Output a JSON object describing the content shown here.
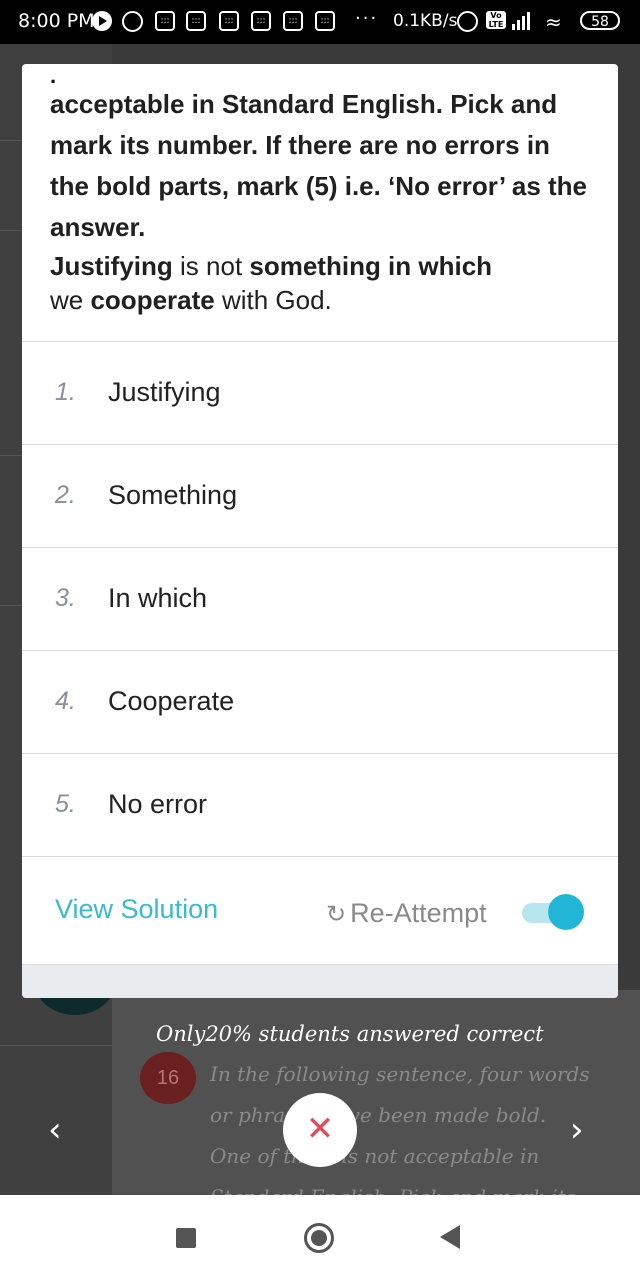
{
  "status_bar": {
    "time": "8:00 PM",
    "network_speed": "0.1KB/s",
    "volte": "Vo LTE",
    "battery": "58",
    "overflow": "···"
  },
  "question": {
    "instruction_tail": "acceptable in Standard English. Pick and mark its number. If there are no errors in the bold parts, mark (5) i.e. ‘No error’ as the answer.",
    "sentence_parts": {
      "w1": "Justifying",
      "w2": " is not ",
      "w3": "something in which",
      "w4": "we ",
      "w5": "cooperate",
      "w6": " with God."
    }
  },
  "options": [
    {
      "num": "1.",
      "label": "Justifying"
    },
    {
      "num": "2.",
      "label": "Something"
    },
    {
      "num": "3.",
      "label": "In which"
    },
    {
      "num": "4.",
      "label": "Cooperate"
    },
    {
      "num": "5.",
      "label": "No error"
    }
  ],
  "footer": {
    "view_solution": "View Solution",
    "reattempt": "Re-Attempt",
    "reattempt_icon": "↻",
    "toggle_on": true
  },
  "background_screen": {
    "stat": "Only20% students answered correct",
    "question_number": "16",
    "question_preview": "In the following sentence, four words or phrases have been made bold. One of them is not acceptable in Standard English. Pick and mark its number. If there are no errors in",
    "prev_icon": "‹",
    "next_icon": "›",
    "close_icon": "✕"
  },
  "colors": {
    "accent": "#3cb8cf",
    "toggle_thumb": "#22b6d6",
    "close": "#e04a5a"
  }
}
